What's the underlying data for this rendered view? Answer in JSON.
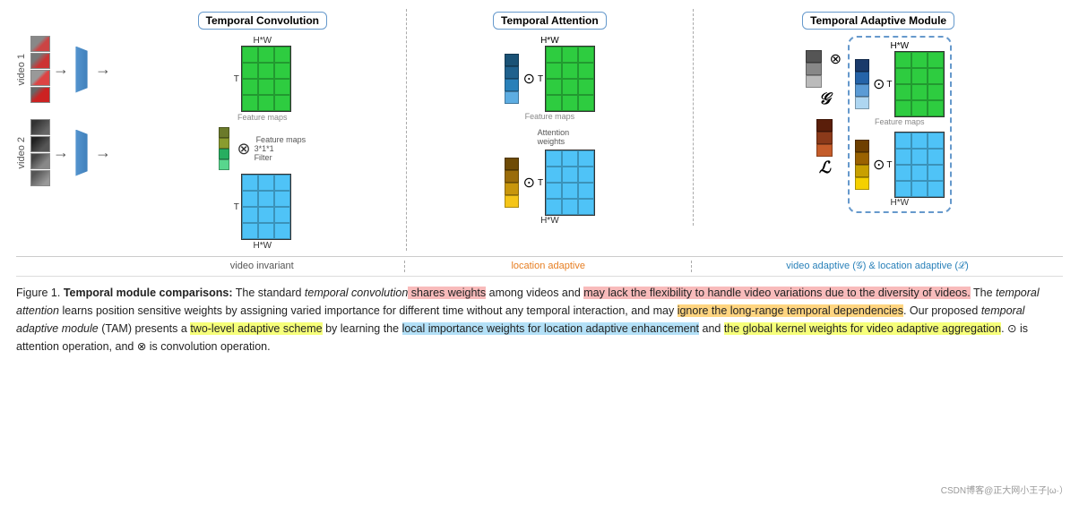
{
  "diagram": {
    "sections": {
      "temporal_convolution": "Temporal Convolution",
      "temporal_attention": "Temporal Attention",
      "temporal_adaptive": "Temporal Adaptive Module"
    },
    "labels": {
      "hw": "H*W",
      "t": "T",
      "filter": "3*1*1\nFilter",
      "feature_maps": "Feature maps",
      "attention_weights": "Attention\nweights",
      "g_script": "𝒢",
      "l_script": "ℒ",
      "video1": "video 1",
      "video2": "video 2",
      "video_invariant": "video invariant",
      "location_adaptive": "location adaptive",
      "video_adaptive": "video adaptive (𝒢) & location adaptive (ℒ)"
    }
  },
  "caption": {
    "figure_label": "Figure 1.",
    "bold_part": "Temporal module comparisons:",
    "text1": " The standard ",
    "italic1": "temporal convolution",
    "hl_red1": " shares weights",
    "text2": " among videos and ",
    "hl_red2": "may lack the flexibility to handle video variations due to the diversity of videos.",
    "text3": "  The ",
    "italic2": "temporal attention",
    "text4": " learns position sensitive weights by assigning varied importance for different time without any temporal interaction, and may ",
    "hl_orange1": "ignore the long-range temporal dependencies",
    "text5": ".  Our proposed ",
    "italic3": "temporal adaptive module",
    "text6": " (TAM) presents a ",
    "hl_yellow1": "two-level adaptive scheme",
    "text7": " by learning the ",
    "hl_blue1": "local importance weights for location adaptive enhancement",
    "text8": " and ",
    "hl_yellow2": "the global kernel weights for video adaptive aggregation",
    "text9": ". ⊙ is attention operation, and ⊗ is convolution operation.",
    "watermark": "CSDN博客@正大网小王子|ω·）"
  }
}
